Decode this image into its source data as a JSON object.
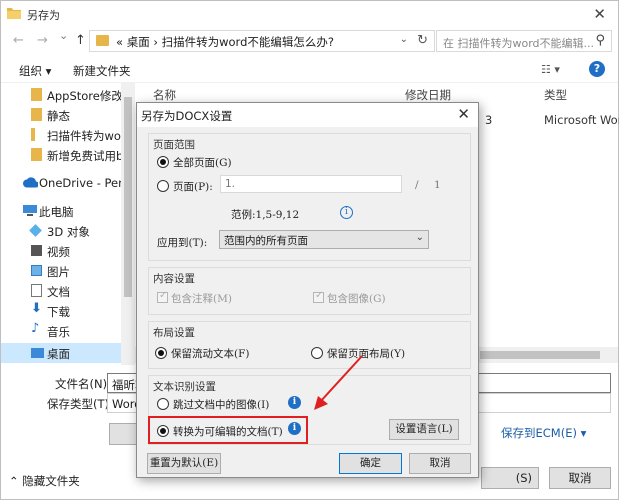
{
  "window": {
    "title": "另存为",
    "close_glyph": "✕"
  },
  "nav": {
    "back_glyph": "←",
    "forward_glyph": "→",
    "down_glyph": "⌄",
    "up_glyph": "↑",
    "breadcrumb": "«  桌面  ›  扫描件转为word不能编辑怎么办?",
    "search_placeholder": "在 扫描件转为word不能编辑..."
  },
  "toolbar": {
    "organize": "组织 ▾",
    "new_folder": "新建文件夹"
  },
  "sidebar": {
    "items": [
      {
        "label": "AppStore修改"
      },
      {
        "label": "静态"
      },
      {
        "label": "扫描件转为word"
      },
      {
        "label": "新增免费试用ba"
      },
      {
        "label": "OneDrive - Persc"
      },
      {
        "label": "此电脑"
      },
      {
        "label": "3D 对象"
      },
      {
        "label": "视频"
      },
      {
        "label": "图片"
      },
      {
        "label": "文档"
      },
      {
        "label": "下载"
      },
      {
        "label": "音乐"
      },
      {
        "label": "桌面"
      }
    ]
  },
  "files": {
    "col_name": "名称",
    "col_modified": "修改日期",
    "col_type": "类型",
    "row_type": "Microsoft Word",
    "row_date_fragment": "3"
  },
  "bottom": {
    "filename_label": "文件名(N):",
    "filename_value": "福昕软",
    "filetype_label": "保存类型(T):",
    "filetype_value": "Word",
    "save_ecm": "保存到ECM(E)  ▾",
    "save_btn": "(S)",
    "cancel_btn": "取消",
    "hide_folders": "隐藏文件夹"
  },
  "dialog": {
    "title": "另存为DOCX设置",
    "close_glyph": "✕",
    "page_range": {
      "title": "页面范围",
      "all_pages": "全部页面(G)",
      "pages": "页面(P):",
      "pages_value": "1.",
      "slash": "/",
      "total": "1",
      "example": "范例:1,5-9,12",
      "apply_label": "应用到(T):",
      "apply_value": "范围内的所有页面"
    },
    "content": {
      "title": "内容设置",
      "include_comments": "包含注释(M)",
      "include_images": "包含图像(G)"
    },
    "layout": {
      "title": "布局设置",
      "keep_flow": "保留流动文本(F)",
      "keep_layout": "保留页面布局(Y)"
    },
    "ocr": {
      "title": "文本识别设置",
      "skip_images": "跳过文档中的图像(I)",
      "convert_editable": "转换为可编辑的文档(T)",
      "set_language": "设置语言(L)"
    },
    "buttons": {
      "reset": "重置为默认(E)",
      "ok": "确定",
      "cancel": "取消"
    }
  },
  "colors": {
    "accent": "#1f6fc5",
    "highlight": "#e02020",
    "selected_bg": "#cce8ff"
  }
}
